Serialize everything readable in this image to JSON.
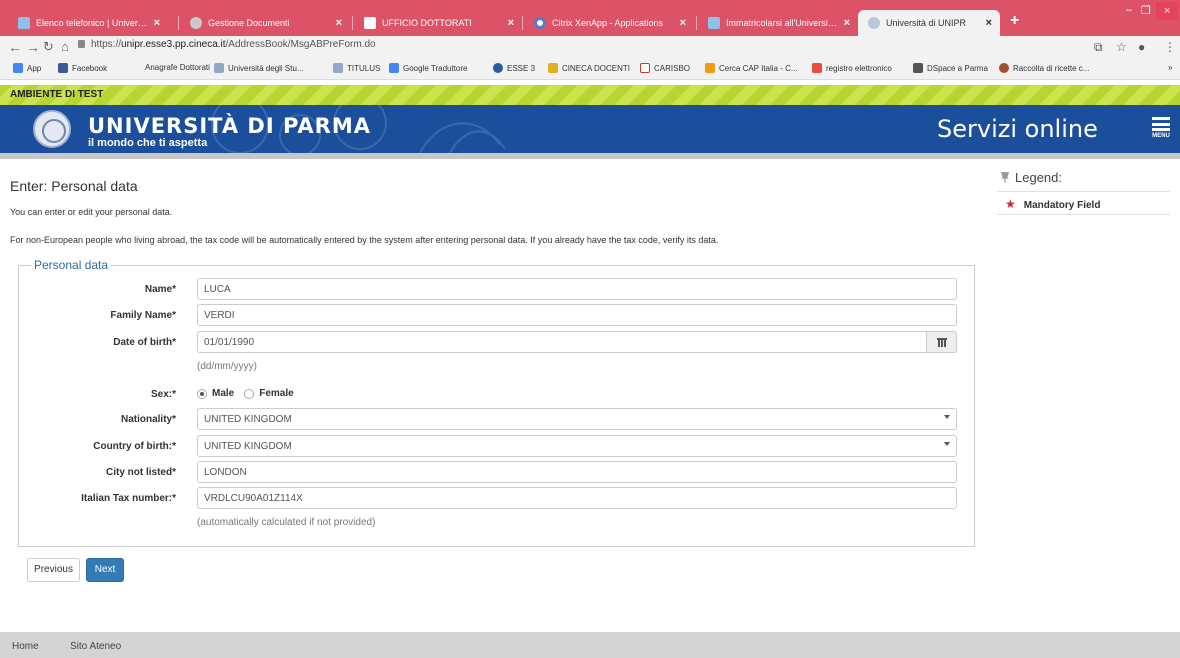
{
  "browser": {
    "tabs": [
      {
        "title": "Elenco telefonico | Università deg",
        "active": false
      },
      {
        "title": "Gestione Documenti",
        "active": false
      },
      {
        "title": "UFFICIO DOTTORATI",
        "active": false
      },
      {
        "title": "Citrix XenApp - Applications",
        "active": false
      },
      {
        "title": "Immatricolarsi all'Università di Pa",
        "active": false
      },
      {
        "title": "Università di UNIPR",
        "active": true
      }
    ],
    "url_prefix": "https://",
    "url_host": "unipr.esse3.pp.cineca.it",
    "url_path": "/AddressBook/MsgABPreForm.do",
    "bookmarks": [
      "App",
      "Facebook",
      "Anagrafe Dottorati",
      "Università degli Stu...",
      "TITULUS",
      "Google Traduttore",
      "ESSE 3",
      "CINECA DOCENTI",
      "CARISBO",
      "Cerca CAP Italia - C...",
      "registro elettronico",
      "DSpace a Parma",
      "Raccolta di ricette c..."
    ]
  },
  "site": {
    "test_banner": "AMBIENTE DI TEST",
    "university": "UNIVERSITÀ DI PARMA",
    "motto": "il mondo che ti aspetta",
    "services": "Servizi online",
    "menu_label": "MENU"
  },
  "page": {
    "title": "Enter:  Personal data",
    "intro1": "You can enter or edit your personal data.",
    "intro2": "For non-European people who living abroad, the tax code will be automatically entered by the system after entering personal data. If you already have the tax code, verify its data."
  },
  "legend": {
    "title": "Legend:",
    "mandatory": "Mandatory Field"
  },
  "form": {
    "fieldset_title": "Personal data",
    "name_label": "Name*",
    "name_value": "LUCA",
    "family_label": "Family Name*",
    "family_value": "VERDI",
    "dob_label": "Date of birth*",
    "dob_value": "01/01/1990",
    "dob_hint": "(dd/mm/yyyy)",
    "sex_label": "Sex:*",
    "sex_male": "Male",
    "sex_female": "Female",
    "nationality_label": "Nationality*",
    "nationality_value": "UNITED KINGDOM",
    "country_label": "Country of birth:*",
    "country_value": "UNITED KINGDOM",
    "city_label": "City not listed*",
    "city_value": "LONDON",
    "tax_label": "Italian Tax number:*",
    "tax_value": "VRDLCU90A01Z114X",
    "tax_hint": "(automatically calculated if not provided)"
  },
  "buttons": {
    "previous": "Previous",
    "next": "Next"
  },
  "footer": {
    "home": "Home",
    "site": "Sito Ateneo"
  },
  "colors": {
    "tabbar": "#dc5368",
    "brand_blue": "#1b4f9c",
    "test_green": "#b6d432",
    "primary_button": "#337ab7",
    "mandatory_star": "#d9232a"
  }
}
